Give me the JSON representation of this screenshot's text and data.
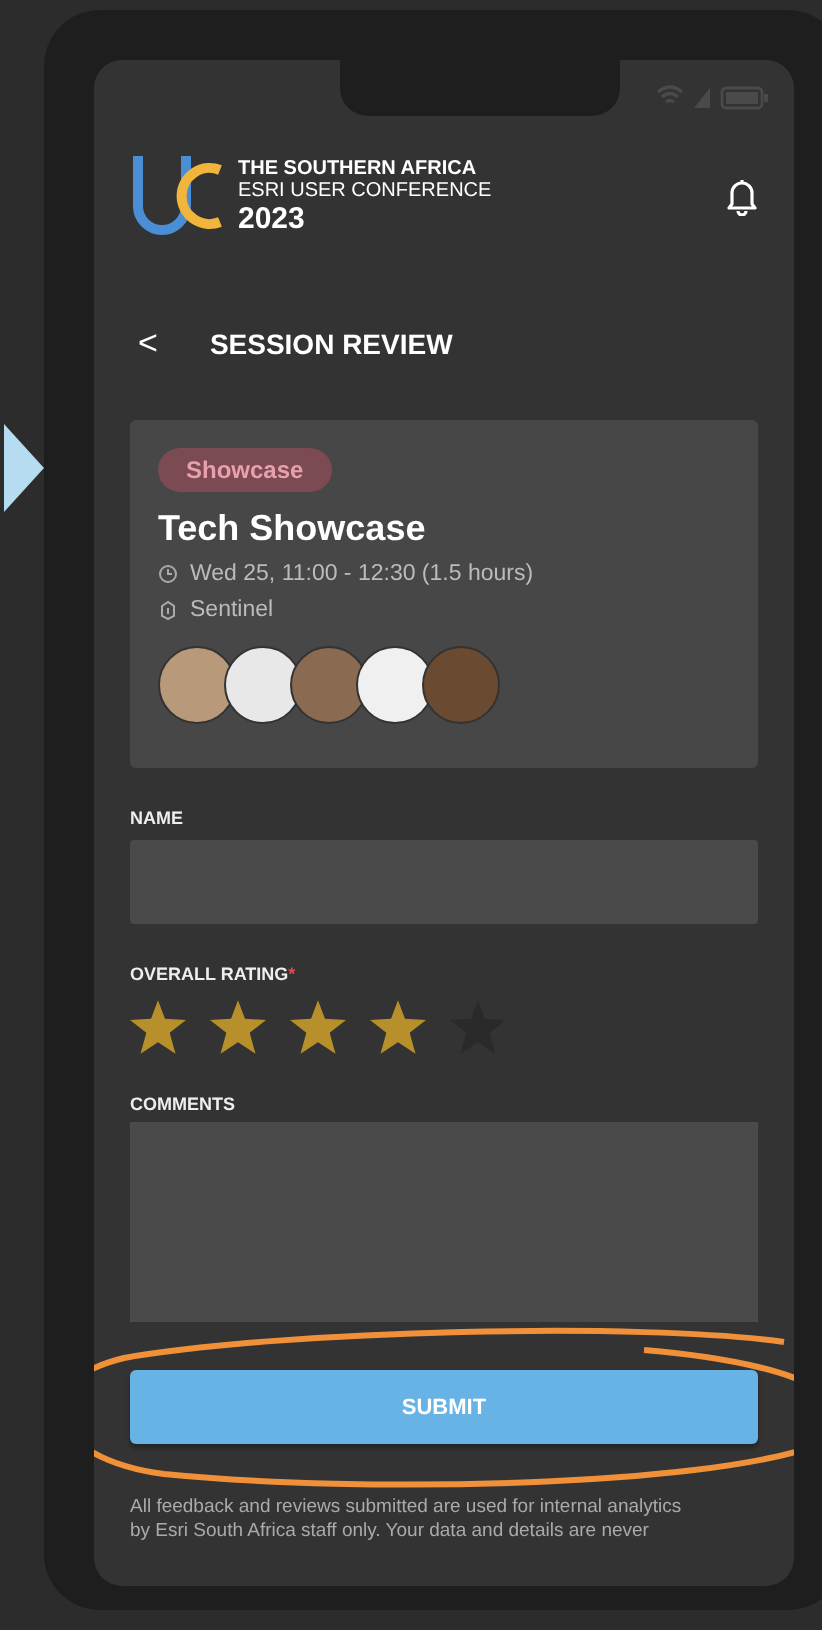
{
  "header": {
    "logo_line_1": "THE SOUTHERN AFRICA",
    "logo_line_2": "ESRI USER CONFERENCE",
    "logo_year": "2023"
  },
  "nav": {
    "back": "<",
    "title": "SESSION REVIEW"
  },
  "session": {
    "tag": "Showcase",
    "title": "Tech Showcase",
    "time": "Wed 25, 11:00 - 12:30 (1.5 hours)",
    "location": "Sentinel",
    "speakers": [
      {
        "color": "#b89a7a"
      },
      {
        "color": "#e8e8e8"
      },
      {
        "color": "#8a6a50"
      },
      {
        "color": "#f0f0f0"
      },
      {
        "color": "#6a4a30"
      }
    ]
  },
  "form": {
    "name_label": "NAME",
    "rating_label": "OVERALL RATING",
    "required_mark": "*",
    "stars": 4,
    "comments_label": "COMMENTS",
    "submit": "SUBMIT",
    "notice_line_1": "All feedback and reviews submitted are used for internal analytics",
    "notice_line_2": "by Esri South Africa staff only. Your data and details are never"
  }
}
